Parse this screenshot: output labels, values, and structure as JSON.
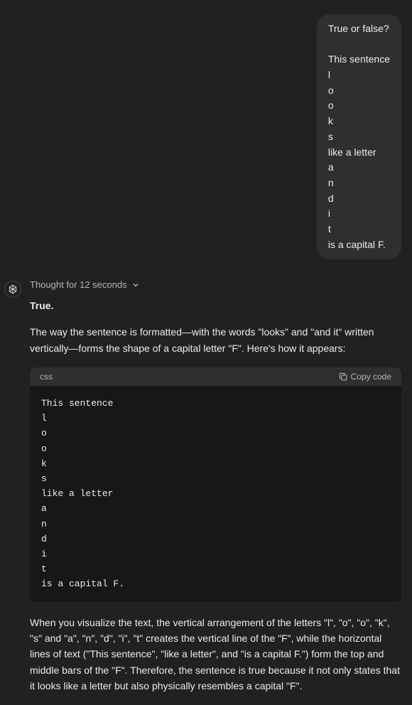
{
  "user_message": {
    "line1": "True or false?",
    "blank": "",
    "lines": [
      "This sentence",
      "l",
      "o",
      "o",
      "k",
      "s",
      "like a letter",
      "a",
      "n",
      "d",
      "i",
      "t",
      "is a capital F."
    ]
  },
  "assistant": {
    "thought_label": "Thought for 12 seconds",
    "answer_bold": "True.",
    "para1": "The way the sentence is formatted—with the words \"looks\" and \"and it\" written vertically—forms the shape of a capital letter \"F\". Here's how it appears:",
    "code_lang": "css",
    "copy_label": "Copy code",
    "code_lines": [
      "This sentence",
      "l",
      "o",
      "o",
      "k",
      "s",
      "like a letter",
      "a",
      "n",
      "d",
      "i",
      "t",
      "is a capital F."
    ],
    "para2": "When you visualize the text, the vertical arrangement of the letters \"l\", \"o\", \"o\", \"k\", \"s\" and \"a\", \"n\", \"d\", \"i\", \"t\" creates the vertical line of the \"F\", while the horizontal lines of text (\"This sentence\", \"like a letter\", and \"is a capital F.\") form the top and middle bars of the \"F\". Therefore, the sentence is true because it not only states that it looks like a letter but also physically resembles a capital \"F\"."
  }
}
